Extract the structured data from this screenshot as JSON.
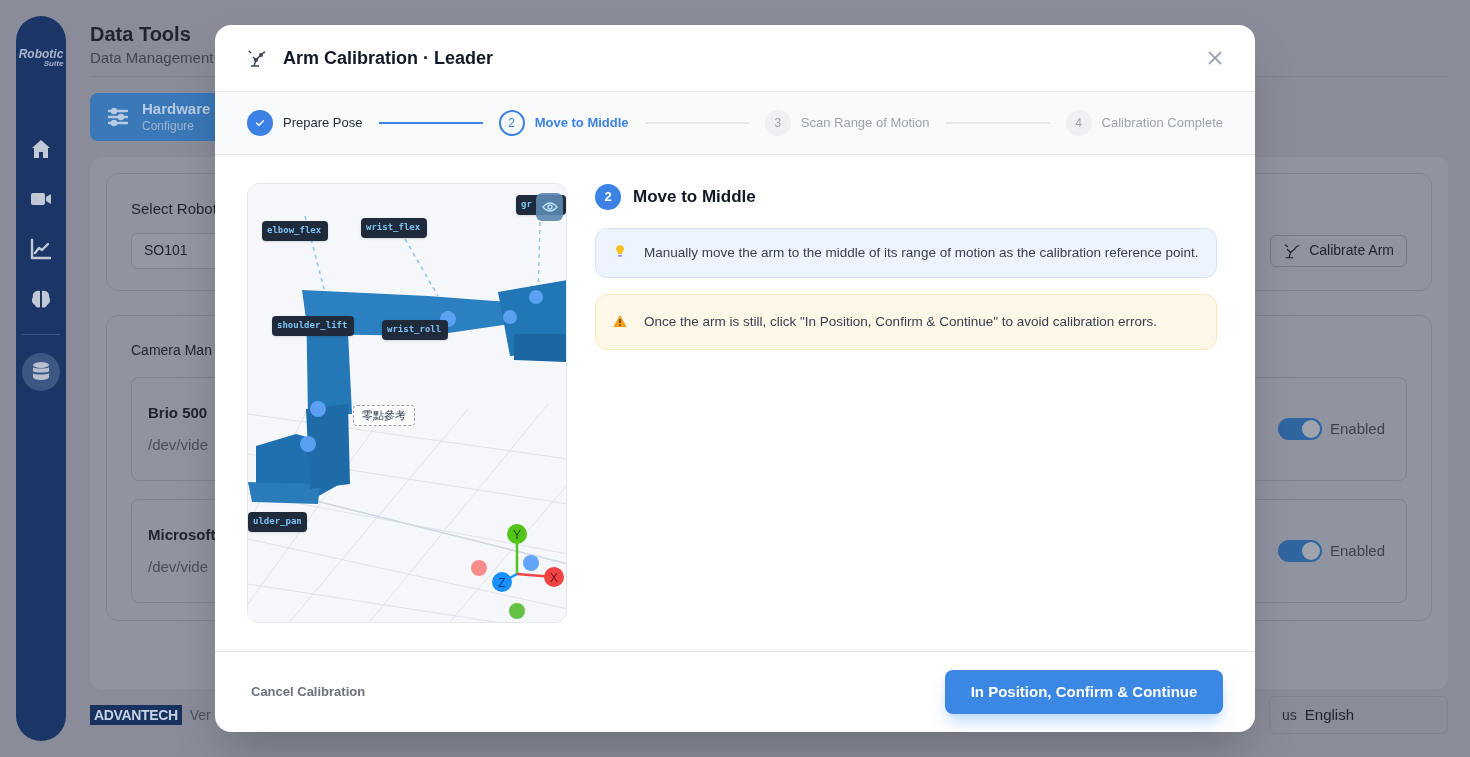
{
  "sidebar": {
    "logo": {
      "line1": "Robotic",
      "line2": "Suite"
    },
    "items": [
      {
        "kind": "home",
        "selected": false
      },
      {
        "kind": "video",
        "selected": false
      },
      {
        "kind": "chart",
        "selected": false
      },
      {
        "kind": "brain",
        "selected": false
      },
      {
        "kind": "database",
        "selected": true
      }
    ]
  },
  "page": {
    "title": "Data Tools",
    "subtitle": "Data Management"
  },
  "tabs": [
    {
      "title": "Hardware",
      "subtitle": "Configure",
      "selected": true
    }
  ],
  "robot_card": {
    "label": "Select Robot",
    "value": "SO101",
    "button": "Calibrate Arm"
  },
  "camera_card": {
    "title": "Camera Man",
    "cameras": [
      {
        "name": "Brio 500",
        "path": "/dev/vide",
        "on": true,
        "status": "Enabled"
      },
      {
        "name": "Microsoft",
        "path": "/dev/vide",
        "on": true,
        "status": "Enabled"
      }
    ]
  },
  "footer": {
    "brand": "ADVANTECH",
    "version": "Ver",
    "language": {
      "flag": "us",
      "label": "English"
    }
  },
  "modal": {
    "title": "Arm Calibration · Leader",
    "steps": [
      {
        "label": "Prepare Pose",
        "done": true,
        "selected": false
      },
      {
        "number": "2",
        "label": "Move to Middle",
        "done": false,
        "selected": true
      },
      {
        "number": "3",
        "label": "Scan Range of Motion",
        "done": false,
        "selected": false
      },
      {
        "number": "4",
        "label": "Calibration Complete",
        "done": false,
        "selected": false
      }
    ],
    "joint_labels": [
      {
        "text": "elbow_flex"
      },
      {
        "text": "wrist_flex"
      },
      {
        "text": "gr"
      },
      {
        "text": "shoulder_lift"
      },
      {
        "text": "wrist_roll"
      },
      {
        "text": "ulder_pan"
      }
    ],
    "zero_label": "零點參考",
    "axes": [
      "Y",
      "X",
      "Z"
    ],
    "step_badge": "2",
    "heading": "Move to Middle",
    "notes": [
      {
        "kind": "info",
        "text": "Manually move the arm to the middle of its range of motion as the calibration reference point."
      },
      {
        "kind": "warning",
        "text": "Once the arm is still, click \"In Position, Confirm & Continue\" to avoid calibration errors."
      }
    ],
    "cancel": "Cancel Calibration",
    "confirm": "In Position, Confirm & Continue"
  }
}
